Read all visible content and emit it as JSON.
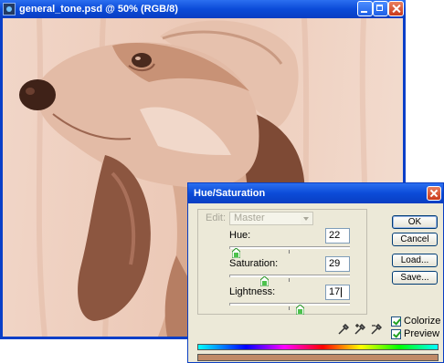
{
  "document": {
    "title": "general_tone.psd @ 50% (RGB/8)",
    "tint_color": "#ecc9b7"
  },
  "dialog": {
    "title": "Hue/Saturation",
    "edit_label": "Edit:",
    "edit_value": "Master",
    "hue": {
      "label": "Hue:",
      "value": "22",
      "level": 0.06
    },
    "saturation": {
      "label": "Saturation:",
      "value": "29",
      "level": 0.29
    },
    "lightness": {
      "label": "Lightness:",
      "value": "17",
      "level": 0.585
    },
    "buttons": {
      "ok": "OK",
      "cancel": "Cancel",
      "load": "Load...",
      "save": "Save..."
    },
    "colorize": {
      "label": "Colorize",
      "checked": true
    },
    "preview": {
      "label": "Preview",
      "checked": true
    },
    "tone_color": "#c08a68"
  }
}
